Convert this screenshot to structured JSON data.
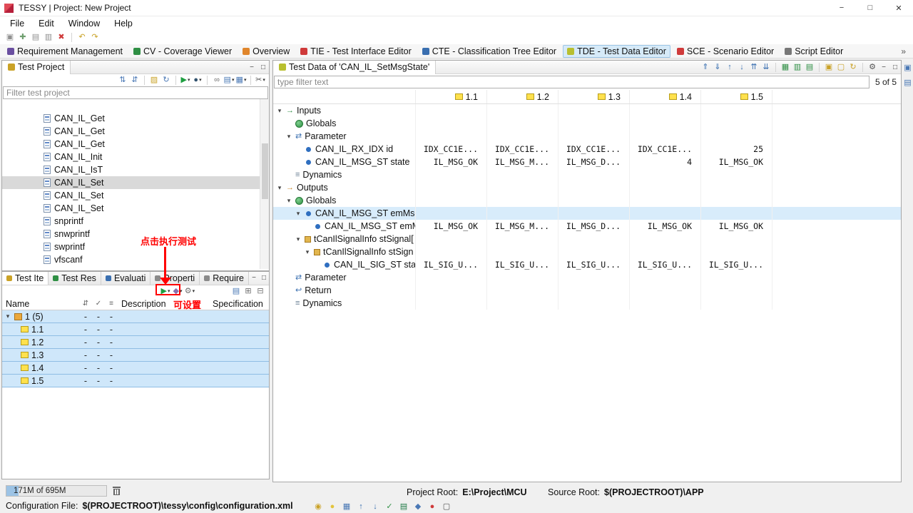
{
  "titlebar": {
    "title": "TESSY | Project: New Project"
  },
  "menubar": {
    "items": [
      "File",
      "Edit",
      "Window",
      "Help"
    ]
  },
  "main_toolbar": {
    "icons": [
      {
        "icon": "save"
      },
      {
        "icon": "add"
      },
      {
        "icon": "copy"
      },
      {
        "icon": "paste"
      },
      {
        "icon": "delete"
      },
      {
        "sep": true
      },
      {
        "icon": "undo"
      },
      {
        "icon": "redo"
      }
    ]
  },
  "perspective_bar": {
    "overflow": "»",
    "items": [
      {
        "label": "Requirement Management",
        "icon_color": "#6a4fa0"
      },
      {
        "label": "CV - Coverage Viewer",
        "icon_color": "#2f8f44"
      },
      {
        "label": "Overview",
        "icon_color": "#e0862c"
      },
      {
        "label": "TIE - Test Interface Editor",
        "icon_color": "#cf3a3a"
      },
      {
        "label": "CTE - Classification Tree Editor",
        "icon_color": "#3a6fb0"
      },
      {
        "label": "TDE - Test Data Editor",
        "icon_color": "#b8bf2f",
        "active": true
      },
      {
        "label": "SCE - Scenario Editor",
        "icon_color": "#cf3a3a"
      },
      {
        "label": "Script Editor",
        "icon_color": "#777777"
      }
    ]
  },
  "test_project": {
    "title": "Test Project",
    "filter_placeholder": "Filter test project",
    "toolbar_icons": [
      {
        "icon": "sort-asc"
      },
      {
        "icon": "sort-desc"
      },
      {
        "sep": true
      },
      {
        "icon": "new-folder"
      },
      {
        "icon": "refresh"
      },
      {
        "sep": true
      },
      {
        "icon": "run",
        "caret": true
      },
      {
        "icon": "coverage",
        "caret": true
      },
      {
        "sep": true
      },
      {
        "icon": "link"
      },
      {
        "icon": "report",
        "caret": true
      },
      {
        "icon": "layout",
        "caret": true
      },
      {
        "sep": true
      },
      {
        "icon": "filter",
        "caret": true
      }
    ],
    "items": [
      {
        "label": "CAN_IL_Get"
      },
      {
        "label": "CAN_IL_Get"
      },
      {
        "label": "CAN_IL_Get"
      },
      {
        "label": "CAN_IL_Init"
      },
      {
        "label": "CAN_IL_IsT"
      },
      {
        "label": "CAN_IL_Set",
        "selected": true
      },
      {
        "label": "CAN_IL_Set"
      },
      {
        "label": "CAN_IL_Set"
      },
      {
        "label": "snprintf"
      },
      {
        "label": "snwprintf"
      },
      {
        "label": "swprintf"
      },
      {
        "label": "vfscanf"
      }
    ]
  },
  "test_items_panel": {
    "tabs": [
      {
        "label": "Test Ite",
        "icon_color": "#caa227",
        "active": true
      },
      {
        "label": "Test Res",
        "icon_color": "#2f8f44"
      },
      {
        "label": "Evaluati",
        "icon_color": "#3a6fb0"
      },
      {
        "label": "Properti",
        "icon_color": "#8a8a8a"
      },
      {
        "label": "Require",
        "icon_color": "#8a8a8a"
      }
    ],
    "toolbar_icons": [
      {
        "icon": "run",
        "caret": true
      },
      {
        "icon": "stamp",
        "caret": true
      },
      {
        "icon": "gear",
        "caret": true
      }
    ],
    "toolbar_right_icons": [
      {
        "icon": "report"
      },
      {
        "icon": "expand"
      },
      {
        "icon": "collapse"
      }
    ],
    "columns": {
      "name": "Name",
      "description": "Description",
      "specification": "Specification"
    },
    "mini_columns": [
      {
        "icon": "sort"
      },
      {
        "icon": "check"
      },
      {
        "icon": "list"
      }
    ],
    "rows": [
      {
        "name": "1 (5)",
        "type": "testcase",
        "c1": "-",
        "c2": "-",
        "c3": "-",
        "description": "",
        "specification": ""
      },
      {
        "name": "1.1",
        "type": "teststep",
        "c1": "-",
        "c2": "-",
        "c3": "-",
        "description": "",
        "specification": ""
      },
      {
        "name": "1.2",
        "type": "teststep",
        "c1": "-",
        "c2": "-",
        "c3": "-",
        "description": "",
        "specification": ""
      },
      {
        "name": "1.3",
        "type": "teststep",
        "c1": "-",
        "c2": "-",
        "c3": "-",
        "description": "",
        "specification": ""
      },
      {
        "name": "1.4",
        "type": "teststep",
        "c1": "-",
        "c2": "-",
        "c3": "-",
        "description": "",
        "specification": ""
      },
      {
        "name": "1.5",
        "type": "teststep",
        "c1": "-",
        "c2": "-",
        "c3": "-",
        "description": "",
        "specification": ""
      }
    ]
  },
  "test_data_panel": {
    "title": "Test Data of 'CAN_IL_SetMsgState'",
    "filter_placeholder": "type filter text",
    "count": "5 of 5",
    "toolbar_icons": [
      {
        "icon": "paste-up"
      },
      {
        "icon": "paste-down"
      },
      {
        "icon": "copy-up"
      },
      {
        "icon": "copy-down"
      },
      {
        "icon": "move-up"
      },
      {
        "icon": "move-down"
      },
      {
        "sep": true
      },
      {
        "icon": "table-green-1"
      },
      {
        "icon": "table-green-2"
      },
      {
        "icon": "table-green-3"
      },
      {
        "sep": true
      },
      {
        "icon": "new-testcase"
      },
      {
        "icon": "new-teststep"
      },
      {
        "icon": "sync"
      },
      {
        "sep": true
      },
      {
        "icon": "settings"
      }
    ],
    "columns": [
      "1.1",
      "1.2",
      "1.3",
      "1.4",
      "1.5"
    ],
    "rows": [
      {
        "label": "Inputs",
        "level": 0,
        "icon": "inputs",
        "chevron": true
      },
      {
        "label": "Globals",
        "level": 1,
        "icon": "globals"
      },
      {
        "label": "Parameter",
        "level": 1,
        "icon": "parameter",
        "chevron": true
      },
      {
        "label": "CAN_IL_RX_IDX id",
        "level": 2,
        "icon": "variable",
        "values": [
          "IDX_CC1E...",
          "IDX_CC1E...",
          "IDX_CC1E...",
          "IDX_CC1E...",
          "25"
        ]
      },
      {
        "label": "CAN_IL_MSG_ST state",
        "level": 2,
        "icon": "variable",
        "values": [
          "IL_MSG_OK",
          "IL_MSG_M...",
          "IL_MSG_D...",
          "4",
          "IL_MSG_OK"
        ]
      },
      {
        "label": "Dynamics",
        "level": 1,
        "icon": "dynamics"
      },
      {
        "label": "Outputs",
        "level": 0,
        "icon": "outputs",
        "chevron": true
      },
      {
        "label": "Globals",
        "level": 1,
        "icon": "globals",
        "chevron": true
      },
      {
        "label": "CAN_IL_MSG_ST emMsgS",
        "level": 2,
        "icon": "variable",
        "chevron": true,
        "selected": true
      },
      {
        "label": "CAN_IL_MSG_ST emM",
        "level": 3,
        "icon": "variable",
        "values": [
          "IL_MSG_OK",
          "IL_MSG_M...",
          "IL_MSG_D...",
          "IL_MSG_OK",
          "IL_MSG_OK"
        ]
      },
      {
        "label": "tCanIlSignalInfo stSignal[",
        "level": 2,
        "icon": "struct",
        "chevron": true
      },
      {
        "label": "tCanIlSignalInfo stSign",
        "level": 3,
        "icon": "struct",
        "chevron": true
      },
      {
        "label": "CAN_IL_SIG_ST state",
        "level": 4,
        "icon": "variable",
        "values": [
          "IL_SIG_U...",
          "IL_SIG_U...",
          "IL_SIG_U...",
          "IL_SIG_U...",
          "IL_SIG_U..."
        ]
      },
      {
        "label": "Parameter",
        "level": 1,
        "icon": "parameter"
      },
      {
        "label": "Return",
        "level": 1,
        "icon": "return"
      },
      {
        "label": "Dynamics",
        "level": 1,
        "icon": "dynamics"
      }
    ]
  },
  "right_strip_icons": [
    {
      "icon": "view-a"
    },
    {
      "icon": "view-b"
    }
  ],
  "bottom_icons": [
    {
      "icon": "pin"
    },
    {
      "icon": "bulb"
    },
    {
      "icon": "grid"
    },
    {
      "icon": "nav-up"
    },
    {
      "icon": "nav-down"
    },
    {
      "icon": "check-green"
    },
    {
      "icon": "excel"
    },
    {
      "icon": "lock"
    },
    {
      "icon": "error"
    },
    {
      "icon": "monitor"
    }
  ],
  "annotations": {
    "run_hint": "点击执行测试",
    "settable_hint": "可设置"
  },
  "status": {
    "memory": "171M of 695M",
    "config_label": "Configuration File:",
    "config_value": "$(PROJECTROOT)\\tessy\\config\\configuration.xml",
    "project_root_label": "Project Root:",
    "project_root_value": "E:\\Project\\MCU",
    "source_root_label": "Source Root:",
    "source_root_value": "$(PROJECTROOT)\\APP"
  }
}
